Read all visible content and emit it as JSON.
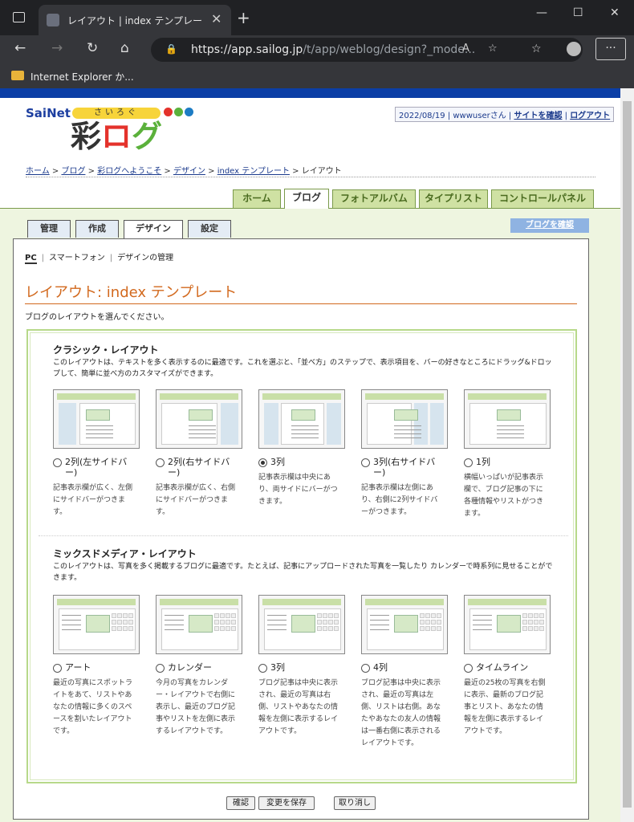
{
  "browser": {
    "tab_title": "レイアウト | index テンプレート | デザイ",
    "url_host": "https://app.sailog.jp",
    "url_path": "/t/app/weblog/design?_mode...",
    "favorites_item": "Internet Explorer か..."
  },
  "site": {
    "logo_brand": "SaiNet",
    "logo_kana": "さいろぐ",
    "logo_main_1": "彩",
    "logo_main_2": "ロ",
    "logo_main_3": "グ",
    "user_info": "2022/08/19 | wwwuserさん |",
    "view_site": "サイトを確認",
    "logout": "ログアウト"
  },
  "breadcrumb": {
    "items": [
      "ホーム",
      "ブログ",
      "彩ログへようこそ",
      "デザイン",
      "index テンプレート"
    ],
    "current": "レイアウト"
  },
  "main_nav": [
    "ホーム",
    "ブログ",
    "フォトアルバム",
    "タイプリスト",
    "コントロールパネル"
  ],
  "sub_tabs": [
    "管理",
    "作成",
    "デザイン",
    "設定"
  ],
  "blog_link": "ブログを確認",
  "sub_nav": {
    "pc": "PC",
    "smartphone": "スマートフォン",
    "design_manage": "デザインの管理"
  },
  "page_title": "レイアウト: index テンプレート",
  "intro": "ブログのレイアウトを選んでください。",
  "classic": {
    "title": "クラシック・レイアウト",
    "desc": "このレイアウトは、テキストを多く表示するのに最適です。これを選ぶと、「並べ方」のステップで、表示項目を、バーの好きなところにドラッグ&ドロップして、簡単に並べ方のカスタマイズができます。",
    "options": [
      {
        "label": "2列(左サイドバー)",
        "desc": "記事表示欄が広く、左側にサイドバーがつきます。"
      },
      {
        "label": "2列(右サイドバー)",
        "desc": "記事表示欄が広く、右側にサイドバーがつきます。"
      },
      {
        "label": "3列",
        "desc": "記事表示欄は中央にあり、両サイドにバーがつきます。"
      },
      {
        "label": "3列(右サイドバー)",
        "desc": "記事表示欄は左側にあり、右側に2列サイドバーがつきます。"
      },
      {
        "label": "1列",
        "desc": "横幅いっぱいが記事表示欄で、ブログ記事の下に各種情報やリストがつきます。"
      }
    ]
  },
  "mixed": {
    "title": "ミックスドメディア・レイアウト",
    "desc": "このレイアウトは、写真を多く掲載するブログに最適です。たとえば、記事にアップロードされた写真を一覧したり カレンダーで時系列に見せることができます。",
    "options": [
      {
        "label": "アート",
        "desc": "最近の写真にスポットライトをあて、リストやあなたの情報に多くのスペースを割いたレイアウトです。"
      },
      {
        "label": "カレンダー",
        "desc": "今月の写真をカレンダー・レイアウトで右側に表示し、最近のブログ記事やリストを左側に表示するレイアウトです。"
      },
      {
        "label": "3列",
        "desc": "ブログ記事は中央に表示され、最近の写真は右側、リストやあなたの情報を左側に表示するレイアウトです。"
      },
      {
        "label": "4列",
        "desc": "ブログ記事は中央に表示され、最近の写真は左側、リストは右側。あなたやあなたの友人の情報は一番右側に表示されるレイアウトです。"
      },
      {
        "label": "タイムライン",
        "desc": "最近の25枚の写真を右側に表示、最新のブログ記事とリスト、あなたの情報を左側に表示するレイアウトです。"
      }
    ]
  },
  "buttons": {
    "confirm": "確認",
    "save": "変更を保存",
    "cancel": "取り消し"
  },
  "selected": "classic-2"
}
